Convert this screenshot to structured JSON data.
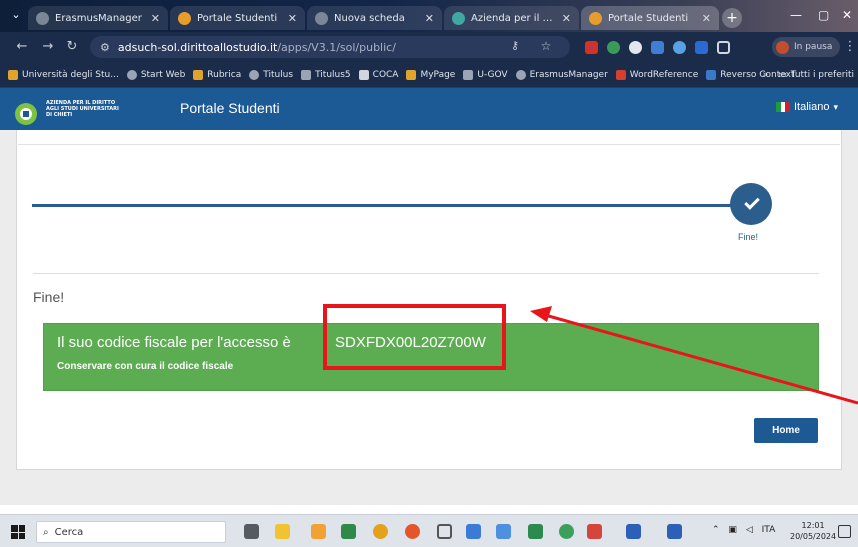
{
  "browser": {
    "tabs": [
      {
        "title": "ErasmusManager",
        "fav_color": "#7b8797"
      },
      {
        "title": "Portale Studenti",
        "fav_color": "#e89c2b"
      },
      {
        "title": "Nuova scheda",
        "fav_color": "#7b8797"
      },
      {
        "title": "Azienda per il diritto agl",
        "fav_color": "#3fa8a0"
      },
      {
        "title": "Portale Studenti",
        "fav_color": "#e89c2b"
      }
    ],
    "url_host": "adsuch-sol.dirittoallostudio.it",
    "url_path": "/apps/V3.1/sol/public/",
    "profile_status": "In pausa",
    "bookmarks": [
      {
        "label": "Università degli Stu...",
        "color": "#e0a32b"
      },
      {
        "label": "Start Web",
        "color": "#9aa4b5"
      },
      {
        "label": "Rubrica",
        "color": "#e0a32b"
      },
      {
        "label": "Titulus",
        "color": "#9aa4b5"
      },
      {
        "label": "Titulus5",
        "color": "#9aa4b5"
      },
      {
        "label": "COCA",
        "color": "#d0d5de"
      },
      {
        "label": "MyPage",
        "color": "#e0a32b"
      },
      {
        "label": "U-GOV",
        "color": "#9aa4b5"
      },
      {
        "label": "ErasmusManager",
        "color": "#9aa4b5"
      },
      {
        "label": "WordReference",
        "color": "#d4402f"
      },
      {
        "label": "Reverso Context",
        "color": "#3a78c9"
      }
    ],
    "bookmarks_overflow": "»",
    "all_favorites": "Tutti i preferiti"
  },
  "portal": {
    "logo_word": "Azienda DSU",
    "logo_text": [
      "AZIENDA PER IL DIRITTO",
      "AGLI STUDI UNIVERSITARI",
      "DI CHIETI"
    ],
    "title": "Portale Studenti",
    "language": "Italiano",
    "language_caret": "▾"
  },
  "content": {
    "step_label": "Fine!",
    "heading": "Fine!",
    "alert_text": "Il suo codice fiscale per l'accesso è",
    "fiscal_code": "SDXFDX00L20Z700W",
    "alert_subtext": "Conservare con cura il codice fiscale",
    "home_button": "Home",
    "accent": "#1d5a93",
    "success": "#5cac52",
    "highlight": "#e8161a"
  },
  "taskbar": {
    "search_placeholder": "Cerca",
    "language": "ITA",
    "time": "12:01",
    "date": "20/05/2024"
  }
}
